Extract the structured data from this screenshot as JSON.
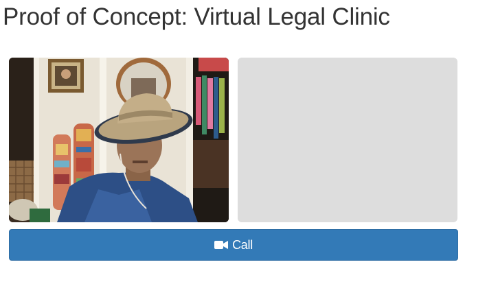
{
  "page": {
    "title": "Proof of Concept: Virtual Legal Clinic"
  },
  "video": {
    "local_feed": "local-camera-feed",
    "remote_feed": "remote-video-placeholder"
  },
  "call_button": {
    "label": "Call",
    "icon": "video-camera-icon"
  },
  "colors": {
    "title_text": "#333333",
    "button_bg": "#337ab7",
    "button_border": "#2e6da4",
    "button_text": "#ffffff",
    "remote_placeholder_bg": "#dddddd"
  }
}
